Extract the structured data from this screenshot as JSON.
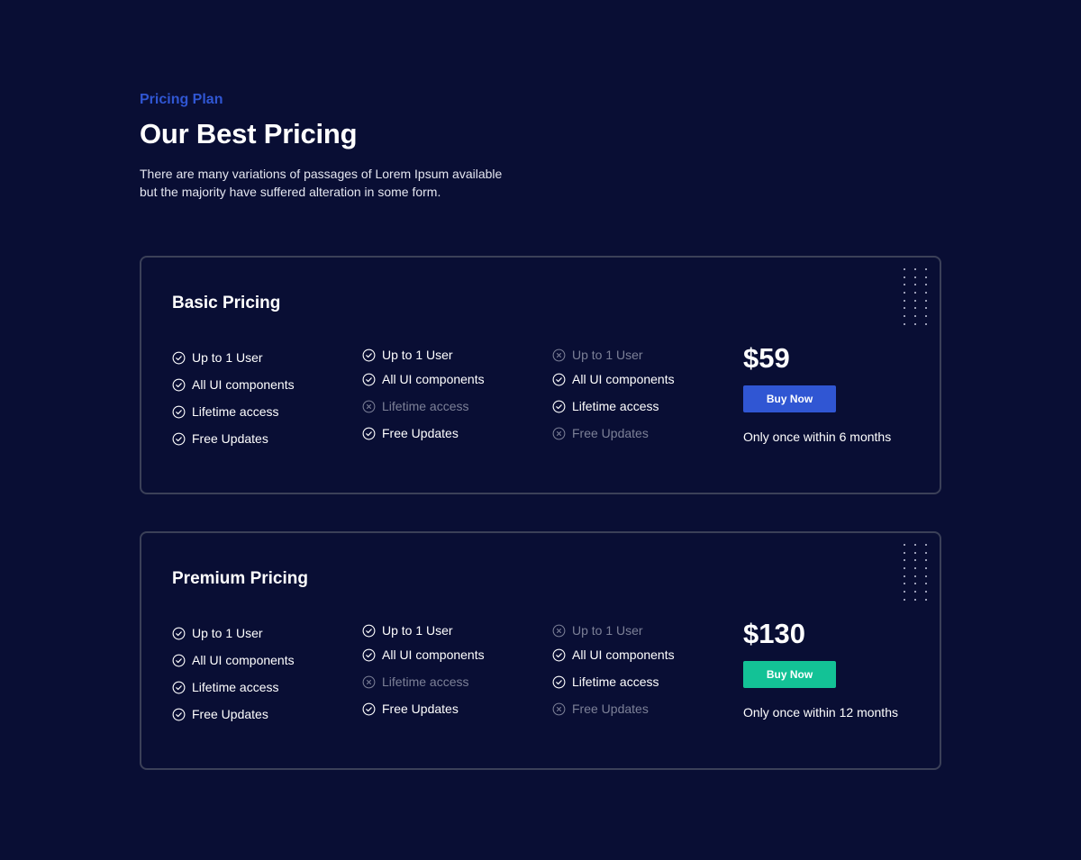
{
  "intro": {
    "eyebrow": "Pricing Plan",
    "title": "Our Best Pricing",
    "description_line1": "There are many variations of passages of Lorem Ipsum available",
    "description_line2": "but the majority have suffered alteration in some form."
  },
  "plans": [
    {
      "title": "Basic Pricing",
      "price": "$59",
      "button_label": "Buy Now",
      "button_color": "#3056d3",
      "note": "Only once within 6 months",
      "columns": [
        [
          {
            "label": "Up to 1 User",
            "included": true
          },
          {
            "label": "All UI components",
            "included": true
          },
          {
            "label": "Lifetime access",
            "included": true
          },
          {
            "label": "Free Updates",
            "included": true
          }
        ],
        [
          {
            "label": "Up to 1 User",
            "included": true
          },
          {
            "label": "All UI components",
            "included": true
          },
          {
            "label": "Lifetime access",
            "included": false
          },
          {
            "label": "Free Updates",
            "included": true
          }
        ],
        [
          {
            "label": "Up to 1 User",
            "included": false
          },
          {
            "label": "All UI components",
            "included": true
          },
          {
            "label": "Lifetime access",
            "included": true
          },
          {
            "label": "Free Updates",
            "included": false
          }
        ]
      ]
    },
    {
      "title": "Premium Pricing",
      "price": "$130",
      "button_label": "Buy Now",
      "button_color": "#13c296",
      "note": "Only once within 12 months",
      "columns": [
        [
          {
            "label": "Up to 1 User",
            "included": true
          },
          {
            "label": "All UI components",
            "included": true
          },
          {
            "label": "Lifetime access",
            "included": true
          },
          {
            "label": "Free Updates",
            "included": true
          }
        ],
        [
          {
            "label": "Up to 1 User",
            "included": true
          },
          {
            "label": "All UI components",
            "included": true
          },
          {
            "label": "Lifetime access",
            "included": false
          },
          {
            "label": "Free Updates",
            "included": true
          }
        ],
        [
          {
            "label": "Up to 1 User",
            "included": false
          },
          {
            "label": "All UI components",
            "included": true
          },
          {
            "label": "Lifetime access",
            "included": true
          },
          {
            "label": "Free Updates",
            "included": false
          }
        ]
      ]
    }
  ],
  "icons": {
    "included": "check-circle-icon",
    "excluded": "x-circle-icon"
  },
  "colors": {
    "background": "#090e34",
    "accent": "#3056d3",
    "muted": "#7c8097"
  }
}
